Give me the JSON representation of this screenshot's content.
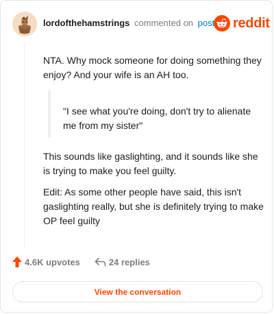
{
  "header": {
    "username": "lordofthehamstrings",
    "action": "commented on",
    "post_link": "post",
    "brand": "reddit"
  },
  "comment": {
    "paragraph_1": "NTA. Why mock someone for doing something they enjoy? And your wife is an AH too.",
    "quote": "\"I see what you're doing, don't try to alienate me from my sister\"",
    "paragraph_2": "This sounds like gaslighting, and it sounds like she is trying to make you feel guilty.",
    "paragraph_3": "Edit: As some other people have said, this isn't gaslighting really, but she is definitely trying to make OP feel guilty"
  },
  "footer": {
    "upvotes": "4.6K upvotes",
    "replies": "24 replies",
    "upvote_icon": "upvote-arrow-icon",
    "reply_icon": "reply-arrow-icon"
  },
  "cta": {
    "label": "View the conversation"
  },
  "colors": {
    "brand": "#ff4500",
    "link": "#0079d3",
    "muted": "#7c7c7c",
    "border": "#e3e5e8"
  }
}
